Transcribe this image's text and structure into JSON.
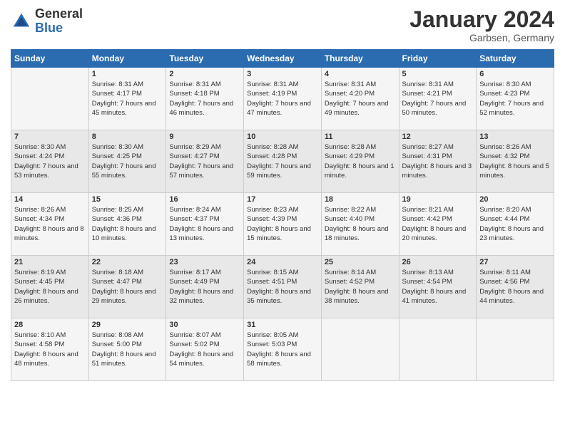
{
  "logo": {
    "general": "General",
    "blue": "Blue"
  },
  "header": {
    "month": "January 2024",
    "location": "Garbsen, Germany"
  },
  "weekdays": [
    "Sunday",
    "Monday",
    "Tuesday",
    "Wednesday",
    "Thursday",
    "Friday",
    "Saturday"
  ],
  "weeks": [
    [
      {
        "day": "",
        "sunrise": "",
        "sunset": "",
        "daylight": ""
      },
      {
        "day": "1",
        "sunrise": "Sunrise: 8:31 AM",
        "sunset": "Sunset: 4:17 PM",
        "daylight": "Daylight: 7 hours and 45 minutes."
      },
      {
        "day": "2",
        "sunrise": "Sunrise: 8:31 AM",
        "sunset": "Sunset: 4:18 PM",
        "daylight": "Daylight: 7 hours and 46 minutes."
      },
      {
        "day": "3",
        "sunrise": "Sunrise: 8:31 AM",
        "sunset": "Sunset: 4:19 PM",
        "daylight": "Daylight: 7 hours and 47 minutes."
      },
      {
        "day": "4",
        "sunrise": "Sunrise: 8:31 AM",
        "sunset": "Sunset: 4:20 PM",
        "daylight": "Daylight: 7 hours and 49 minutes."
      },
      {
        "day": "5",
        "sunrise": "Sunrise: 8:31 AM",
        "sunset": "Sunset: 4:21 PM",
        "daylight": "Daylight: 7 hours and 50 minutes."
      },
      {
        "day": "6",
        "sunrise": "Sunrise: 8:30 AM",
        "sunset": "Sunset: 4:23 PM",
        "daylight": "Daylight: 7 hours and 52 minutes."
      }
    ],
    [
      {
        "day": "7",
        "sunrise": "Sunrise: 8:30 AM",
        "sunset": "Sunset: 4:24 PM",
        "daylight": "Daylight: 7 hours and 53 minutes."
      },
      {
        "day": "8",
        "sunrise": "Sunrise: 8:30 AM",
        "sunset": "Sunset: 4:25 PM",
        "daylight": "Daylight: 7 hours and 55 minutes."
      },
      {
        "day": "9",
        "sunrise": "Sunrise: 8:29 AM",
        "sunset": "Sunset: 4:27 PM",
        "daylight": "Daylight: 7 hours and 57 minutes."
      },
      {
        "day": "10",
        "sunrise": "Sunrise: 8:28 AM",
        "sunset": "Sunset: 4:28 PM",
        "daylight": "Daylight: 7 hours and 59 minutes."
      },
      {
        "day": "11",
        "sunrise": "Sunrise: 8:28 AM",
        "sunset": "Sunset: 4:29 PM",
        "daylight": "Daylight: 8 hours and 1 minute."
      },
      {
        "day": "12",
        "sunrise": "Sunrise: 8:27 AM",
        "sunset": "Sunset: 4:31 PM",
        "daylight": "Daylight: 8 hours and 3 minutes."
      },
      {
        "day": "13",
        "sunrise": "Sunrise: 8:26 AM",
        "sunset": "Sunset: 4:32 PM",
        "daylight": "Daylight: 8 hours and 5 minutes."
      }
    ],
    [
      {
        "day": "14",
        "sunrise": "Sunrise: 8:26 AM",
        "sunset": "Sunset: 4:34 PM",
        "daylight": "Daylight: 8 hours and 8 minutes."
      },
      {
        "day": "15",
        "sunrise": "Sunrise: 8:25 AM",
        "sunset": "Sunset: 4:36 PM",
        "daylight": "Daylight: 8 hours and 10 minutes."
      },
      {
        "day": "16",
        "sunrise": "Sunrise: 8:24 AM",
        "sunset": "Sunset: 4:37 PM",
        "daylight": "Daylight: 8 hours and 13 minutes."
      },
      {
        "day": "17",
        "sunrise": "Sunrise: 8:23 AM",
        "sunset": "Sunset: 4:39 PM",
        "daylight": "Daylight: 8 hours and 15 minutes."
      },
      {
        "day": "18",
        "sunrise": "Sunrise: 8:22 AM",
        "sunset": "Sunset: 4:40 PM",
        "daylight": "Daylight: 8 hours and 18 minutes."
      },
      {
        "day": "19",
        "sunrise": "Sunrise: 8:21 AM",
        "sunset": "Sunset: 4:42 PM",
        "daylight": "Daylight: 8 hours and 20 minutes."
      },
      {
        "day": "20",
        "sunrise": "Sunrise: 8:20 AM",
        "sunset": "Sunset: 4:44 PM",
        "daylight": "Daylight: 8 hours and 23 minutes."
      }
    ],
    [
      {
        "day": "21",
        "sunrise": "Sunrise: 8:19 AM",
        "sunset": "Sunset: 4:45 PM",
        "daylight": "Daylight: 8 hours and 26 minutes."
      },
      {
        "day": "22",
        "sunrise": "Sunrise: 8:18 AM",
        "sunset": "Sunset: 4:47 PM",
        "daylight": "Daylight: 8 hours and 29 minutes."
      },
      {
        "day": "23",
        "sunrise": "Sunrise: 8:17 AM",
        "sunset": "Sunset: 4:49 PM",
        "daylight": "Daylight: 8 hours and 32 minutes."
      },
      {
        "day": "24",
        "sunrise": "Sunrise: 8:15 AM",
        "sunset": "Sunset: 4:51 PM",
        "daylight": "Daylight: 8 hours and 35 minutes."
      },
      {
        "day": "25",
        "sunrise": "Sunrise: 8:14 AM",
        "sunset": "Sunset: 4:52 PM",
        "daylight": "Daylight: 8 hours and 38 minutes."
      },
      {
        "day": "26",
        "sunrise": "Sunrise: 8:13 AM",
        "sunset": "Sunset: 4:54 PM",
        "daylight": "Daylight: 8 hours and 41 minutes."
      },
      {
        "day": "27",
        "sunrise": "Sunrise: 8:11 AM",
        "sunset": "Sunset: 4:56 PM",
        "daylight": "Daylight: 8 hours and 44 minutes."
      }
    ],
    [
      {
        "day": "28",
        "sunrise": "Sunrise: 8:10 AM",
        "sunset": "Sunset: 4:58 PM",
        "daylight": "Daylight: 8 hours and 48 minutes."
      },
      {
        "day": "29",
        "sunrise": "Sunrise: 8:08 AM",
        "sunset": "Sunset: 5:00 PM",
        "daylight": "Daylight: 8 hours and 51 minutes."
      },
      {
        "day": "30",
        "sunrise": "Sunrise: 8:07 AM",
        "sunset": "Sunset: 5:02 PM",
        "daylight": "Daylight: 8 hours and 54 minutes."
      },
      {
        "day": "31",
        "sunrise": "Sunrise: 8:05 AM",
        "sunset": "Sunset: 5:03 PM",
        "daylight": "Daylight: 8 hours and 58 minutes."
      },
      {
        "day": "",
        "sunrise": "",
        "sunset": "",
        "daylight": ""
      },
      {
        "day": "",
        "sunrise": "",
        "sunset": "",
        "daylight": ""
      },
      {
        "day": "",
        "sunrise": "",
        "sunset": "",
        "daylight": ""
      }
    ]
  ]
}
